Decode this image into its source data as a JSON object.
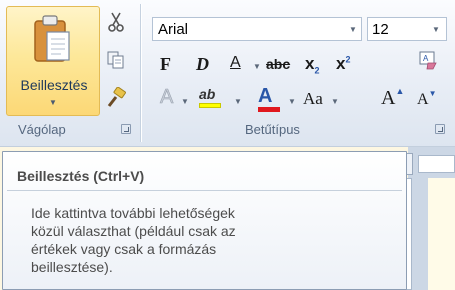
{
  "clipboard": {
    "paste_label": "Beillesztés",
    "group_label": "Vágólap"
  },
  "font": {
    "font_name": "Arial",
    "font_size": "12",
    "group_label": "Betűtípus",
    "bold_label": "F",
    "italic_label": "D",
    "underline_label": "A",
    "strike_label": "abc",
    "subscript_label": "x",
    "subscript_mark": "2",
    "superscript_label": "x",
    "superscript_mark": "2",
    "text_effects_label": "A",
    "highlight_label": "ab",
    "font_color_label": "A",
    "change_case_label": "Aa",
    "grow_font_label": "A",
    "shrink_font_label": "A",
    "clear_format_label": "A"
  },
  "tooltip": {
    "title": "Beillesztés (Ctrl+V)",
    "lines": [
      "Ide kattintva további lehetőségek",
      "közül választhat (például csak az",
      "értékek vagy csak a formázás",
      "beillesztése)."
    ]
  },
  "colors": {
    "highlight": "#ffff00",
    "font_color": "#e0181e",
    "paste_hover": "#fde89a"
  }
}
